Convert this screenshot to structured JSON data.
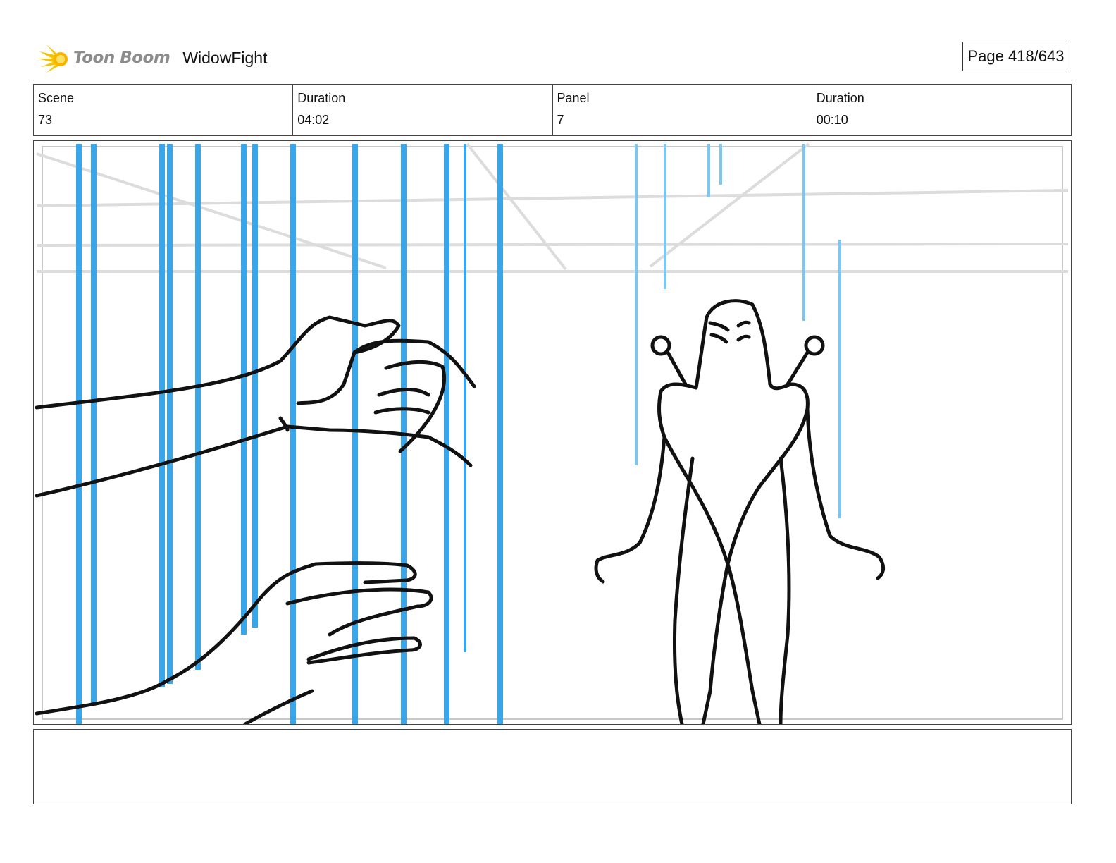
{
  "header": {
    "logo_text": "Toon Boom",
    "project_title": "WidowFight",
    "page_indicator": "Page 418/643"
  },
  "info": {
    "scene_label": "Scene",
    "scene_value": "73",
    "scene_duration_label": "Duration",
    "scene_duration_value": "04:02",
    "panel_label": "Panel",
    "panel_value": "7",
    "panel_duration_label": "Duration",
    "panel_duration_value": "00:10"
  },
  "panel": {
    "image_subject": "storyboard-sketch-hands-behind-energy-bars-and-creature",
    "colors": {
      "energy_bars": "#3aa6ea",
      "energy_bars_light": "#7cc6f2",
      "ink": "#111111",
      "background_lines": "#d9d9d9"
    }
  },
  "notes": {
    "text": ""
  },
  "colors": {
    "logo_star": "#f5c400",
    "border": "#444444"
  }
}
